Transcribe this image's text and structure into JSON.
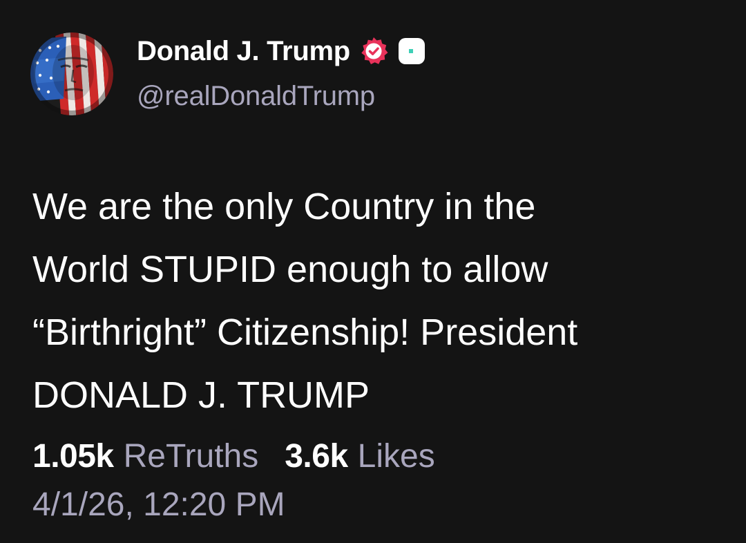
{
  "author": {
    "display_name": "Donald J. Trump",
    "handle": "@realDonaldTrump",
    "avatar_icon": "flag-face-avatar",
    "verified_icon": "verified-badge-icon",
    "verified_color": "#e8325a",
    "app_badge_icon": "app-badge-icon"
  },
  "post": {
    "lines": [
      "We are the only Country in the",
      "World STUPID enough to allow",
      "“Birthright” Citizenship! President",
      "DONALD J. TRUMP"
    ]
  },
  "stats": {
    "retruths_count": "1.05k",
    "retruths_label": "ReTruths",
    "likes_count": "3.6k",
    "likes_label": "Likes"
  },
  "timestamp": "4/1/26, 12:20 PM",
  "colors": {
    "background": "#141414",
    "primary_text": "#ffffff",
    "secondary_text": "#a9a6bd",
    "teal_accent": "#3ecfb6"
  }
}
